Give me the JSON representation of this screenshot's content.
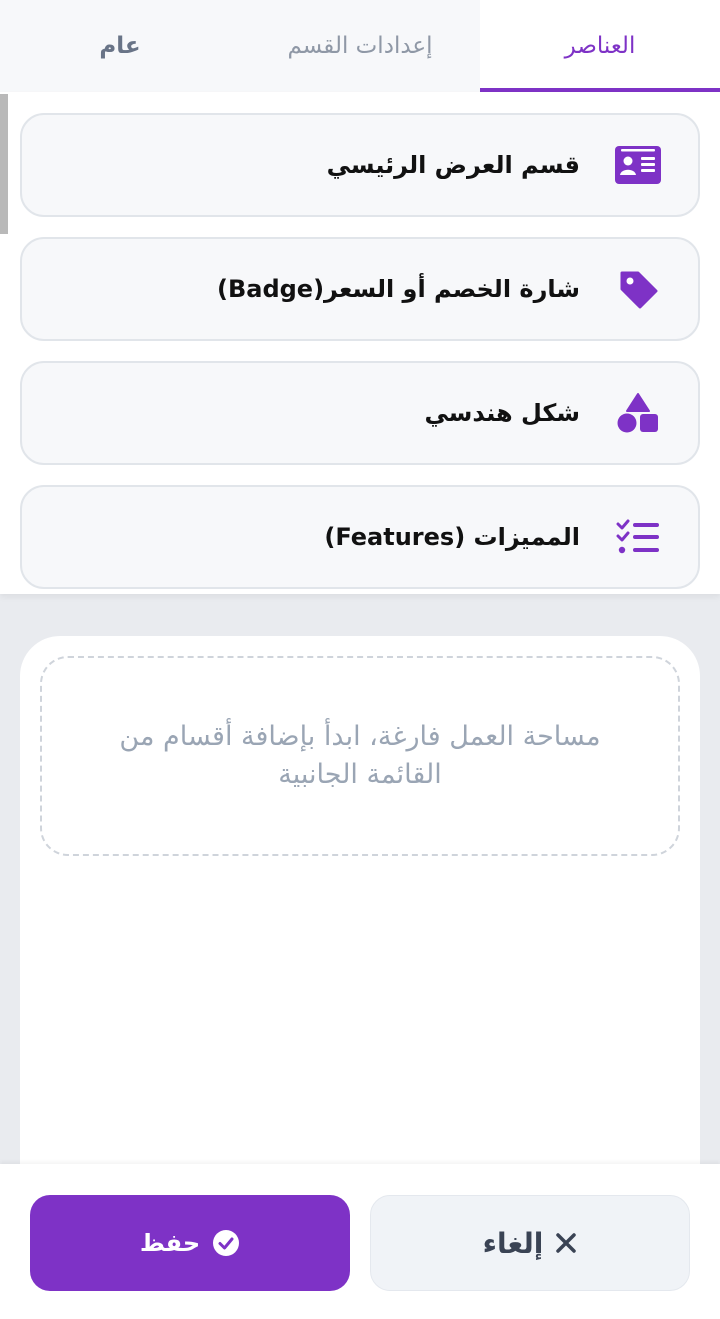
{
  "tabs": {
    "elements": "العناصر",
    "section_settings": "إعدادات القسم",
    "general": "عام"
  },
  "elements": [
    {
      "label": "قسم العرض الرئيسي",
      "icon": "id-card-icon"
    },
    {
      "label": "شارة الخصم أو السعر(Badge)",
      "icon": "tag-icon"
    },
    {
      "label": "شكل هندسي",
      "icon": "shapes-icon"
    },
    {
      "label": "المميزات (Features)",
      "icon": "checklist-icon"
    }
  ],
  "canvas": {
    "empty_message": "مساحة العمل فارغة، ابدأ بإضافة أقسام من القائمة الجانبية"
  },
  "actions": {
    "cancel_label": "إلغاء",
    "save_label": "حفظ"
  },
  "colors": {
    "accent": "#7e32c6",
    "tab_inactive": "#8f98a6",
    "placeholder": "#9aa5b4",
    "cancel_bg": "#f0f3f7"
  }
}
